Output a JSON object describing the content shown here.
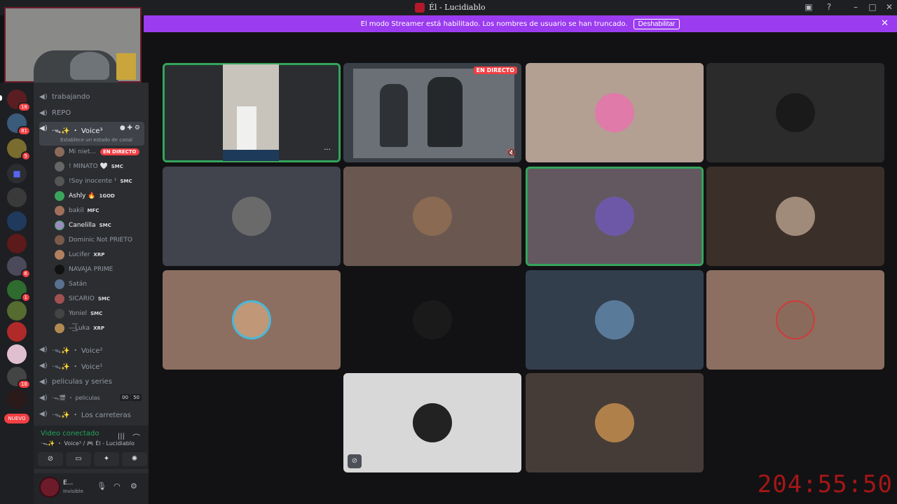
{
  "window": {
    "title": "Él - Lucidiablo"
  },
  "banner": {
    "message": "El modo Streamer está habilitado. Los nombres de usuario se han truncado.",
    "button": "Deshabilitar"
  },
  "guilds": {
    "badges": [
      "18",
      "81",
      "5",
      "6",
      "1",
      "18"
    ],
    "new_label": "NUEVO"
  },
  "channels": {
    "items": [
      {
        "name": "trabajando"
      },
      {
        "name": "REPO"
      },
      {
        "name": "·ᯓ✨ ・ Voice³",
        "status": "Establece un estado de canal"
      },
      {
        "name": "·ᯓ✨ ・ Voice²"
      },
      {
        "name": "·ᯓ✨ ・ Voice¹"
      },
      {
        "name": "peliculas y series"
      },
      {
        "name": "·ᯓ🎬 ・ peliculas",
        "count_a": "00",
        "count_b": "50"
      },
      {
        "name": "·ᯓ✨ ・ Los carreteras"
      }
    ],
    "members": [
      {
        "name": "Mi niet...",
        "live": "EN DIRECTO"
      },
      {
        "name": "! MINATO 🤍",
        "tag": "SMC"
      },
      {
        "name": "!Soy inocente ¹",
        "tag": "SMC"
      },
      {
        "name": "Ashly 🔥",
        "tag": "1GOD"
      },
      {
        "name": "bakil",
        "tag": "MFC"
      },
      {
        "name": "Canelilla",
        "tag": "SMC"
      },
      {
        "name": "Dominic Not PRIETO",
        "tag": ""
      },
      {
        "name": "Lucifer",
        "tag": "XRP"
      },
      {
        "name": "NAVAJA PRIME",
        "tag": ""
      },
      {
        "name": "Satán",
        "tag": ""
      },
      {
        "name": "SICARIO",
        "tag": "SMC"
      },
      {
        "name": "Yoniel",
        "tag": "SMC"
      },
      {
        "name": "—͟͞Luka",
        "tag": "XRP"
      }
    ]
  },
  "voice_panel": {
    "status": "Video conectado",
    "channel": "·ᯓ✨ ・ Voice³ / 🎮 Él - Lucidiablo"
  },
  "user_panel": {
    "name": "E...",
    "status": "Invisible"
  },
  "stream": {
    "live_tag": "EN DIRECTO"
  },
  "timer": "204:55:50",
  "icons": {
    "speaker": "speaker-icon",
    "mic": "microphone-icon",
    "headset": "headset-icon",
    "gear": "gear-icon",
    "close": "close-icon"
  }
}
